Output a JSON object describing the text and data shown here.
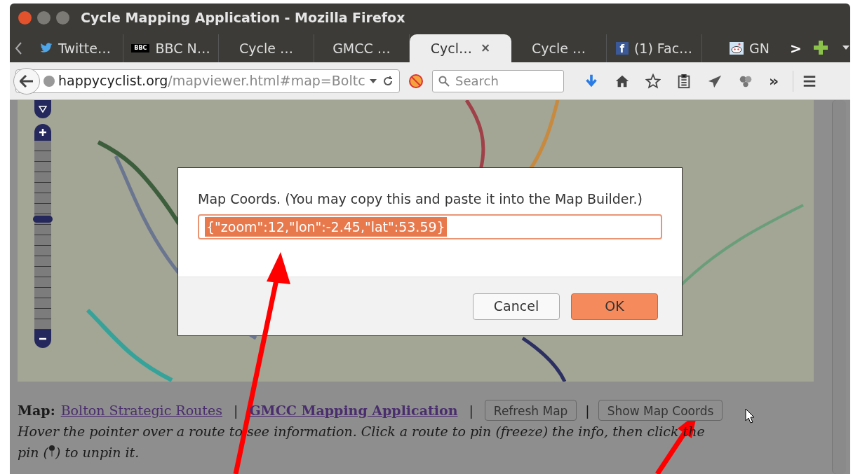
{
  "window": {
    "title": "Cycle Mapping Application - Mozilla Firefox"
  },
  "tabs": [
    {
      "label": "Twitte…",
      "selected": false,
      "kind": "bird"
    },
    {
      "label": "BBC N…",
      "selected": false,
      "badge": "BBC"
    },
    {
      "label": "Cycle …",
      "selected": false
    },
    {
      "label": "GMCC …",
      "selected": false
    },
    {
      "label": "Cycl…",
      "selected": true,
      "close": "×"
    },
    {
      "label": "Cycle …",
      "selected": false
    },
    {
      "label": "(1) Fac…",
      "selected": false,
      "badge": "f"
    },
    {
      "label": "GN",
      "selected": false,
      "kind": "alien"
    }
  ],
  "tab_scroll_right": ">",
  "address": {
    "domain": "happycyclist.org",
    "path": "/mapviewer.html#map=Boltc"
  },
  "search": {
    "placeholder": "Search"
  },
  "toolbar_overflow": "»",
  "map": {
    "zoom_slider": {
      "level": 0.59
    }
  },
  "dialog": {
    "message": "Map Coords. (You may copy this and paste it into the Map Builder.)",
    "value": "{\"zoom\":12,\"lon\":-2.45,\"lat\":53.59}",
    "value_selected": true,
    "buttons": [
      {
        "label": "Cancel",
        "default": false
      },
      {
        "label": "OK",
        "default": true
      }
    ]
  },
  "footer": {
    "map_label": "Map:",
    "links": [
      {
        "label": "Bolton Strategic Routes",
        "bold": false
      },
      {
        "label": "GMCC Mapping Application",
        "bold": true
      }
    ],
    "separator": "|",
    "buttons": [
      "Refresh Map",
      "Show Map Coords"
    ],
    "hint_line": "Hover the pointer over a route to see information. Click a route to pin (freeze) the info, then click the",
    "hint_before": "pin (",
    "hint_after": ") to unpin it."
  }
}
